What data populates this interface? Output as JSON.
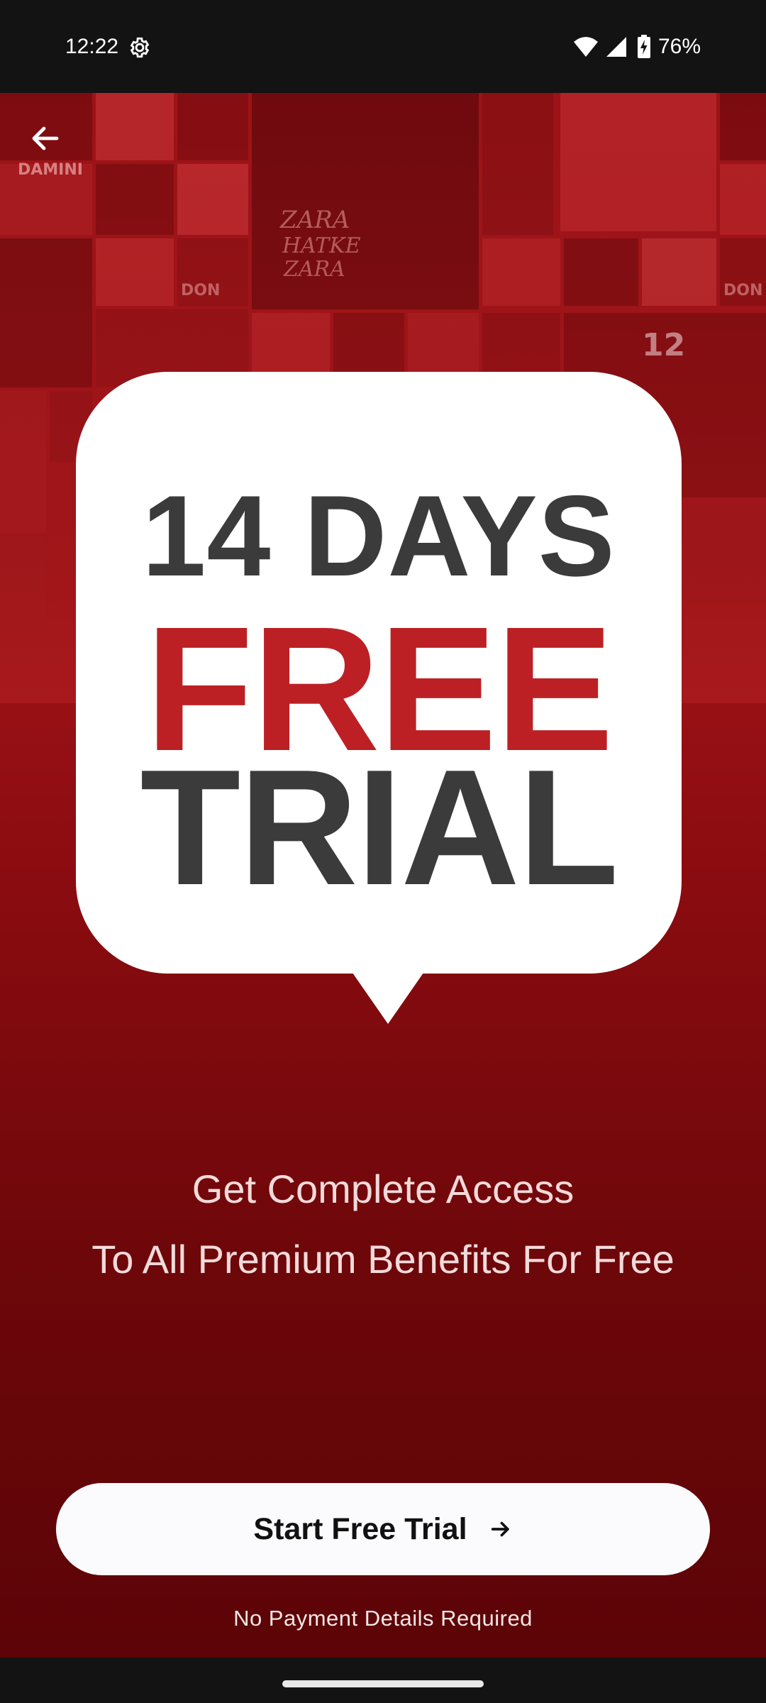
{
  "status_bar": {
    "time": "12:22",
    "battery": "76%",
    "icons": [
      "gear-icon",
      "wifi-icon",
      "signal-icon",
      "battery-charging-icon"
    ]
  },
  "header": {
    "back_icon": "arrow-left-icon"
  },
  "card": {
    "days": "14 DAYS",
    "free": "FREE",
    "trial": "TRIAL"
  },
  "subtitle": {
    "line1": "Get Complete Access",
    "line2": "To All Premium Benefits For Free"
  },
  "cta": {
    "label": "Start Free Trial",
    "icon": "arrow-right-icon"
  },
  "footnote": "No Payment Details Required",
  "colors": {
    "accent_red": "#bc2024",
    "dark_text": "#3b3b3b",
    "background_top": "#a7191c",
    "background_bottom": "#5c0407"
  }
}
